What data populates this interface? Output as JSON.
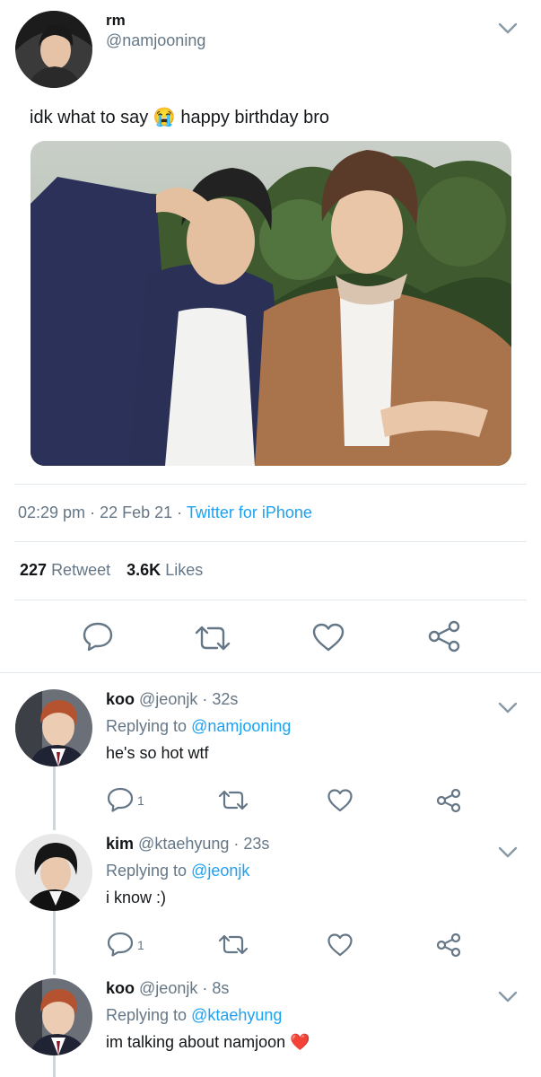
{
  "main_tweet": {
    "display_name": "rm",
    "handle": "@namjooning",
    "text_before": "idk what to say",
    "emoji": "😭",
    "text_after": "happy birthday bro",
    "time": "02:29 pm",
    "sep1": "·",
    "date": "22 Feb 21",
    "sep2": "·",
    "source": "Twitter for iPhone",
    "retweets_count": "227",
    "retweets_label": "Retweet",
    "likes_count": "3.6K",
    "likes_label": "Likes"
  },
  "replies": [
    {
      "name": "koo",
      "handle": "@jeonjk",
      "time": "· 32s",
      "replying_label": "Replying to",
      "replying_to": "@namjooning",
      "text": "he's so hot wtf",
      "reply_count": "1"
    },
    {
      "name": "kim",
      "handle": "@ktaehyung",
      "time": "· 23s",
      "replying_label": "Replying to",
      "replying_to": "@jeonjk",
      "text": "i know :)",
      "reply_count": "1"
    },
    {
      "name": "koo",
      "handle": "@jeonjk",
      "time": "· 8s",
      "replying_label": "Replying to",
      "replying_to": "@ktaehyung",
      "text": "im talking about namjoon",
      "emoji": "❤️"
    }
  ],
  "icons": {
    "reply": "reply-icon",
    "retweet": "retweet-icon",
    "like": "heart-icon",
    "share": "share-icon",
    "more": "chevron-down-icon"
  },
  "colors": {
    "link": "#1da1f2",
    "muted": "#657786",
    "icon": "#657786",
    "divider": "#e1e8ed"
  }
}
